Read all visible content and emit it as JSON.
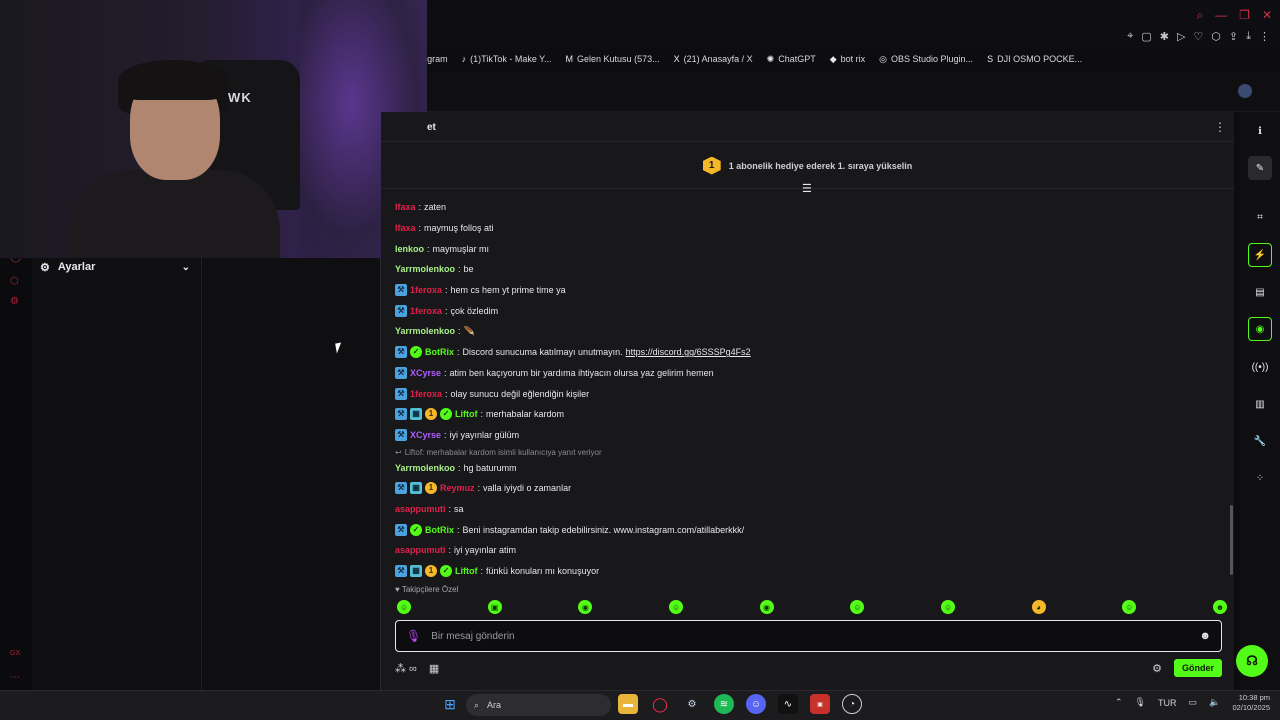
{
  "bookmarks": [
    {
      "icon": "instagram-icon",
      "label": "gram"
    },
    {
      "icon": "tiktok-icon",
      "label": "(1)TikTok - Make Y..."
    },
    {
      "icon": "gmail-icon",
      "label": "Gelen Kutusu (573..."
    },
    {
      "icon": "x-icon",
      "label": "(21) Anasayfa / X"
    },
    {
      "icon": "chatgpt-icon",
      "label": "ChatGPT"
    },
    {
      "icon": "botrix-icon",
      "label": "bot rix"
    },
    {
      "icon": "obs-icon",
      "label": "OBS Studio Plugin..."
    },
    {
      "icon": "dji-icon",
      "label": "DJI OSMO POCKE..."
    }
  ],
  "webcam": {
    "brand": "HAWK"
  },
  "sidebar": {
    "settings_label": "Ayarlar"
  },
  "chat": {
    "title": "et",
    "promo_badge": "1",
    "promo_text": "1 abonelik hediye ederek 1. sıraya yükselin",
    "messages": [
      {
        "user": "lfaxa",
        "user_color": "#e0204a",
        "badges": [],
        "text": "zaten"
      },
      {
        "user": "lfaxa",
        "user_color": "#e0204a",
        "badges": [],
        "text": "maymuş folloş ati"
      },
      {
        "user": "lenkoo",
        "user_color": "#a8f08a",
        "badges": [],
        "text": "maymuşlar mı"
      },
      {
        "user": "Yarrmolenkoo",
        "user_color": "#a8f08a",
        "badges": [],
        "text": "be"
      },
      {
        "user": "1feroxa",
        "user_color": "#e0204a",
        "badges": [
          "mod"
        ],
        "text": "hem cs hem yt prime time ya"
      },
      {
        "user": "1feroxa",
        "user_color": "#e0204a",
        "badges": [
          "mod"
        ],
        "text": "çok özledim"
      },
      {
        "user": "Yarrmolenkoo",
        "user_color": "#a8f08a",
        "badges": [],
        "text": "🪶"
      },
      {
        "user": "BotRix",
        "user_color": "#53fc18",
        "badges": [
          "mod",
          "ver"
        ],
        "text": "Discord sunucuma katılmayı unutmayın.",
        "link": "https://discord.gg/6SSSPg4Fs2"
      },
      {
        "user": "XCyrse",
        "user_color": "#b05cff",
        "badges": [
          "mod"
        ],
        "text": "atim ben kaçıyorum bir yardıma ihtiyacın olursa yaz gelirim hemen"
      },
      {
        "user": "1feroxa",
        "user_color": "#e0204a",
        "badges": [
          "mod"
        ],
        "text": "olay sunucu değil eğlendiğin kişiler"
      },
      {
        "user": "Liftof",
        "user_color": "#53fc18",
        "badges": [
          "mod",
          "vip",
          "sub",
          "ver"
        ],
        "text": "merhabalar kardom"
      },
      {
        "user": "XCyrse",
        "user_color": "#b05cff",
        "badges": [
          "mod"
        ],
        "text": "iyi yayınlar gülüm"
      },
      {
        "user": "Yarrmolenkoo",
        "user_color": "#a8f08a",
        "badges": [],
        "text": "hg baturumm",
        "reply": "Liftof: merhabalar kardom isimli kullanıcıya yanıt veriyor"
      },
      {
        "user": "Reymuz",
        "user_color": "#e0204a",
        "badges": [
          "mod",
          "vip",
          "sub"
        ],
        "text": "valla iyiydi o zamanlar"
      },
      {
        "user": "asappumuti",
        "user_color": "#e0204a",
        "badges": [],
        "text": "sa"
      },
      {
        "user": "BotRix",
        "user_color": "#53fc18",
        "badges": [
          "mod",
          "ver"
        ],
        "text": "Beni instagramdan takip edebilirsiniz. www.instagram.com/atillaberkkk/"
      },
      {
        "user": "asappumuti",
        "user_color": "#e0204a",
        "badges": [],
        "text": "iyi yayınlar atim"
      },
      {
        "user": "Liftof",
        "user_color": "#53fc18",
        "badges": [
          "mod",
          "vip",
          "sub",
          "ver"
        ],
        "text": "fünkü konuları mı konuşuyor"
      }
    ],
    "followers_only": "Takipçilere Özel",
    "input_placeholder": "Bir mesaj gönderin",
    "send_label": "Gönder"
  },
  "taskbar": {
    "search_label": "Ara",
    "lang": "TUR",
    "time": "10:38 pm",
    "date": "02/10/2025"
  },
  "colors": {
    "accent": "#53fc18",
    "brand_red": "#ff2a4a"
  }
}
